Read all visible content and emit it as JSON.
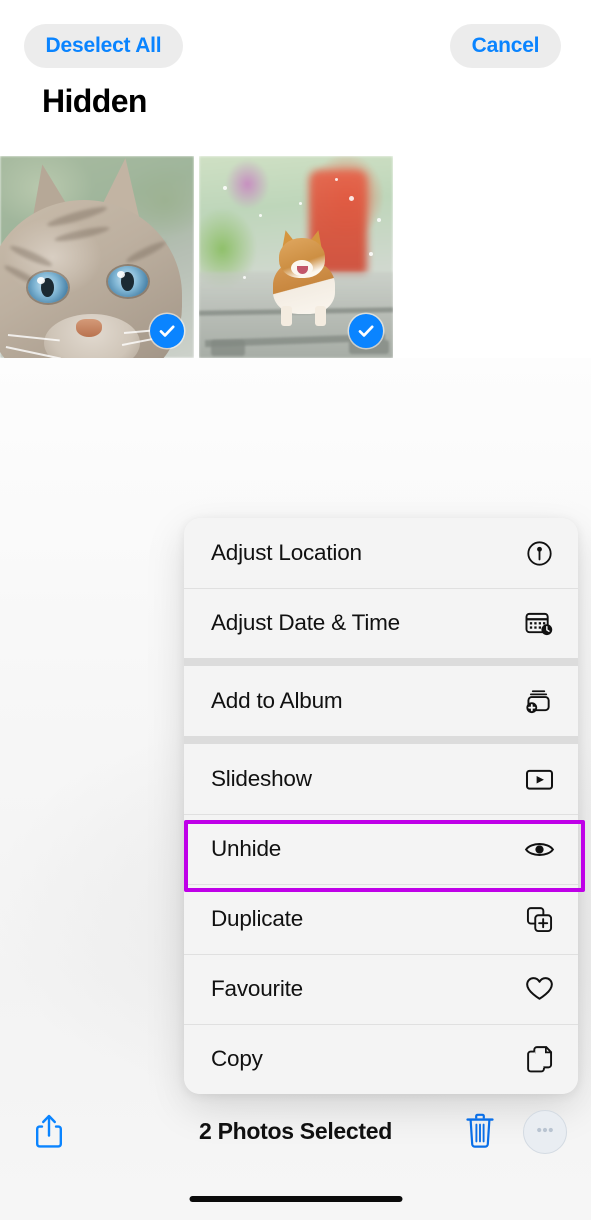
{
  "app": {
    "screen_title": "Hidden",
    "accent_color": "#0a84ff",
    "highlight_color": "#bf00e8"
  },
  "top_bar": {
    "deselect_all_label": "Deselect All",
    "cancel_label": "Cancel"
  },
  "photo_grid": {
    "photos": [
      {
        "name": "cat-photo",
        "alt": "Close-up of a grey tabby cat with blue eyes",
        "selected": true
      },
      {
        "name": "dog-photo",
        "alt": "Corgi dog standing on railway tracks in the rain",
        "selected": true
      }
    ],
    "checkmark_icon": "checkmark-circle-icon"
  },
  "context_menu": {
    "groups": [
      {
        "items": [
          {
            "label": "Adjust Location",
            "icon": "location-pin-circle-icon"
          },
          {
            "label": "Adjust Date & Time",
            "icon": "calendar-clock-icon"
          }
        ]
      },
      {
        "items": [
          {
            "label": "Add to Album",
            "icon": "add-to-album-icon"
          }
        ]
      },
      {
        "items": [
          {
            "label": "Slideshow",
            "icon": "play-rectangle-icon"
          },
          {
            "label": "Unhide",
            "icon": "eye-icon",
            "highlighted": true
          },
          {
            "label": "Duplicate",
            "icon": "duplicate-plus-icon"
          },
          {
            "label": "Favourite",
            "icon": "heart-icon"
          },
          {
            "label": "Copy",
            "icon": "copy-pages-icon"
          }
        ]
      }
    ]
  },
  "bottom_toolbar": {
    "share_icon": "share-arrow-up-icon",
    "selection_status": "2 Photos Selected",
    "delete_icon": "trash-icon",
    "more_icon": "ellipsis-circle-icon"
  }
}
